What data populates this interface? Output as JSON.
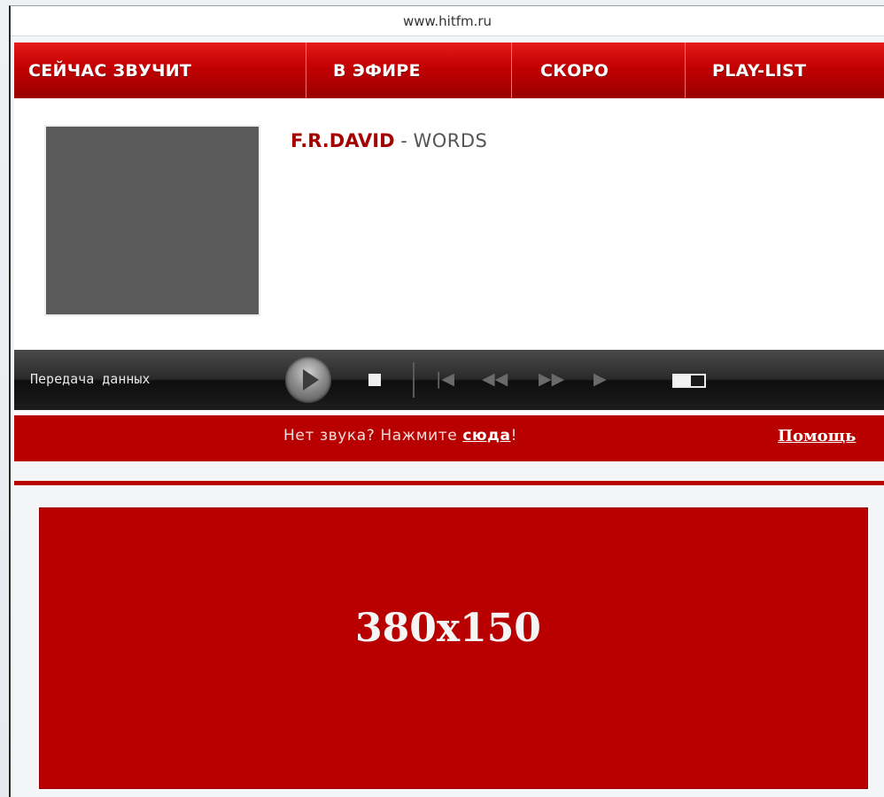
{
  "window": {
    "url": "www.hitfm.ru"
  },
  "nav": {
    "tabs": [
      {
        "label": "СЕЙЧАС ЗВУЧИТ"
      },
      {
        "label": "В ЭФИРЕ"
      },
      {
        "label": "СКОРО"
      },
      {
        "label": "PLAY-LIST"
      }
    ]
  },
  "now_playing": {
    "artist": "F.R.DAVID",
    "separator": " - ",
    "title": "WORDS"
  },
  "player": {
    "status": "Передача данных",
    "controls": {
      "play_icon": "play-icon",
      "stop_icon": "stop-icon",
      "prev_glyph": "|◀",
      "rew_glyph": "◀◀",
      "ff_glyph": "▶▶",
      "next_glyph": "▶"
    },
    "volume_level": 0.55
  },
  "infobar": {
    "message": "Нет звука? Нажмите ",
    "link_here": "сюда",
    "exclamation": "!",
    "help_link": "Помощь"
  },
  "banner": {
    "size_text": "380x150"
  },
  "colors": {
    "accent_red": "#b80000",
    "artist_red": "#a50000",
    "player_dark": "#1c1c1c"
  }
}
